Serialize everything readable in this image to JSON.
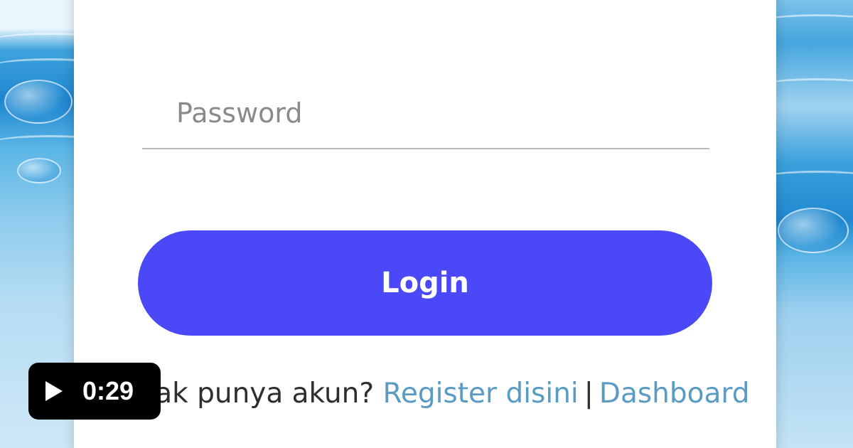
{
  "login_form": {
    "password_placeholder": "Password",
    "login_label": "Login"
  },
  "footer": {
    "prompt_text": "Tidak punya akun?",
    "register_link": "Register disini",
    "separator": "|",
    "dashboard_link": "Dashboard"
  },
  "video": {
    "duration": "0:29",
    "icon": "play-icon"
  },
  "colors": {
    "accent": "#4a48f7",
    "link": "#5a9bc4",
    "water": "#3fa3dd"
  }
}
